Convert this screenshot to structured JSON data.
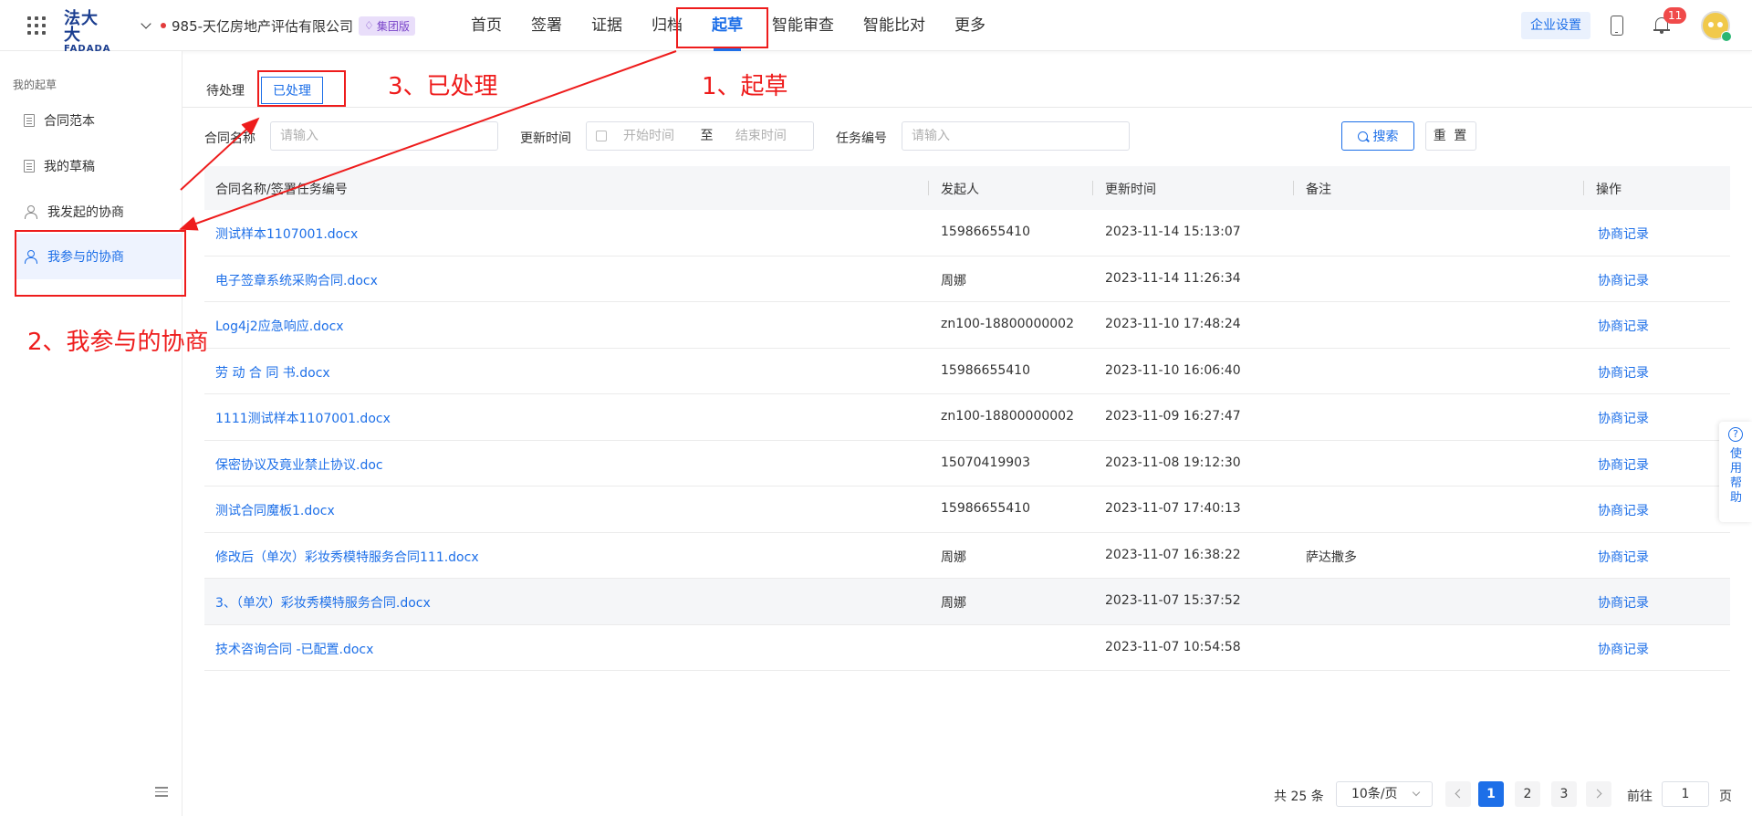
{
  "header": {
    "logo_line1": "法大大",
    "logo_line2": "FADADA",
    "org_name": "985-天亿房地产评估有限公司",
    "org_badge": "集团版",
    "nav": [
      "首页",
      "签署",
      "证据",
      "归档",
      "起草",
      "智能审查",
      "智能比对",
      "更多"
    ],
    "active_nav": "起草",
    "enterprise_settings": "企业设置",
    "notification_count": "11"
  },
  "sidebar": {
    "group_label": "我的起草",
    "items": [
      "合同范本",
      "我的草稿",
      "我发起的协商",
      "我参与的协商"
    ],
    "active_item": "我参与的协商"
  },
  "tabs": {
    "pending": "待处理",
    "processed": "已处理"
  },
  "filters": {
    "contract_name_label": "合同名称",
    "contract_name_placeholder": "请输入",
    "update_time_label": "更新时间",
    "start_placeholder": "开始时间",
    "range_sep": "至",
    "end_placeholder": "结束时间",
    "task_no_label": "任务编号",
    "task_no_placeholder": "请输入",
    "search_button": "搜索",
    "reset_button": "重 置"
  },
  "table": {
    "columns": [
      "合同名称/签署任务编号",
      "发起人",
      "更新时间",
      "备注",
      "操作"
    ],
    "rows": [
      {
        "name": "测试样本1107001.docx",
        "initiator": "15986655410",
        "time": "2023-11-14 15:13:07",
        "note": "",
        "action": "协商记录"
      },
      {
        "name": "电子签章系统采购合同.docx",
        "initiator": "周娜",
        "time": "2023-11-14 11:26:34",
        "note": "",
        "action": "协商记录"
      },
      {
        "name": "Log4j2应急响应.docx",
        "initiator": "zn100-18800000002",
        "time": "2023-11-10 17:48:24",
        "note": "",
        "action": "协商记录"
      },
      {
        "name": "劳 动 合 同 书.docx",
        "initiator": "15986655410",
        "time": "2023-11-10 16:06:40",
        "note": "",
        "action": "协商记录"
      },
      {
        "name": "1111测试样本1107001.docx",
        "initiator": "zn100-18800000002",
        "time": "2023-11-09 16:27:47",
        "note": "",
        "action": "协商记录"
      },
      {
        "name": "保密协议及竟业禁止协议.doc",
        "initiator": "15070419903",
        "time": "2023-11-08 19:12:30",
        "note": "",
        "action": "协商记录"
      },
      {
        "name": "测试合同魔板1.docx",
        "initiator": "15986655410",
        "time": "2023-11-07 17:40:13",
        "note": "",
        "action": "协商记录"
      },
      {
        "name": "修改后（单次）彩妆秀模特服务合同111.docx",
        "initiator": "周娜",
        "time": "2023-11-07 16:38:22",
        "note": "萨达撒多",
        "action": "协商记录"
      },
      {
        "name": "3、（单次）彩妆秀模特服务合同.docx",
        "initiator": "周娜",
        "time": "2023-11-07 15:37:52",
        "note": "",
        "action": "协商记录"
      },
      {
        "name": "技术咨询合同 -已配置.docx",
        "initiator": "",
        "time": "2023-11-07 10:54:58",
        "note": "",
        "action": "协商记录"
      }
    ]
  },
  "help": {
    "label": "使用帮助"
  },
  "pagination": {
    "total": "共 25 条",
    "page_size": "10条/页",
    "pages": [
      "1",
      "2",
      "3"
    ],
    "current_page": "1",
    "goto_label": "前往",
    "goto_value": "1",
    "goto_unit": "页"
  },
  "annotations": {
    "step1": "1、起草",
    "step2": "2、我参与的协商",
    "step3": "3、已处理",
    "color": "#ee1c1c"
  }
}
